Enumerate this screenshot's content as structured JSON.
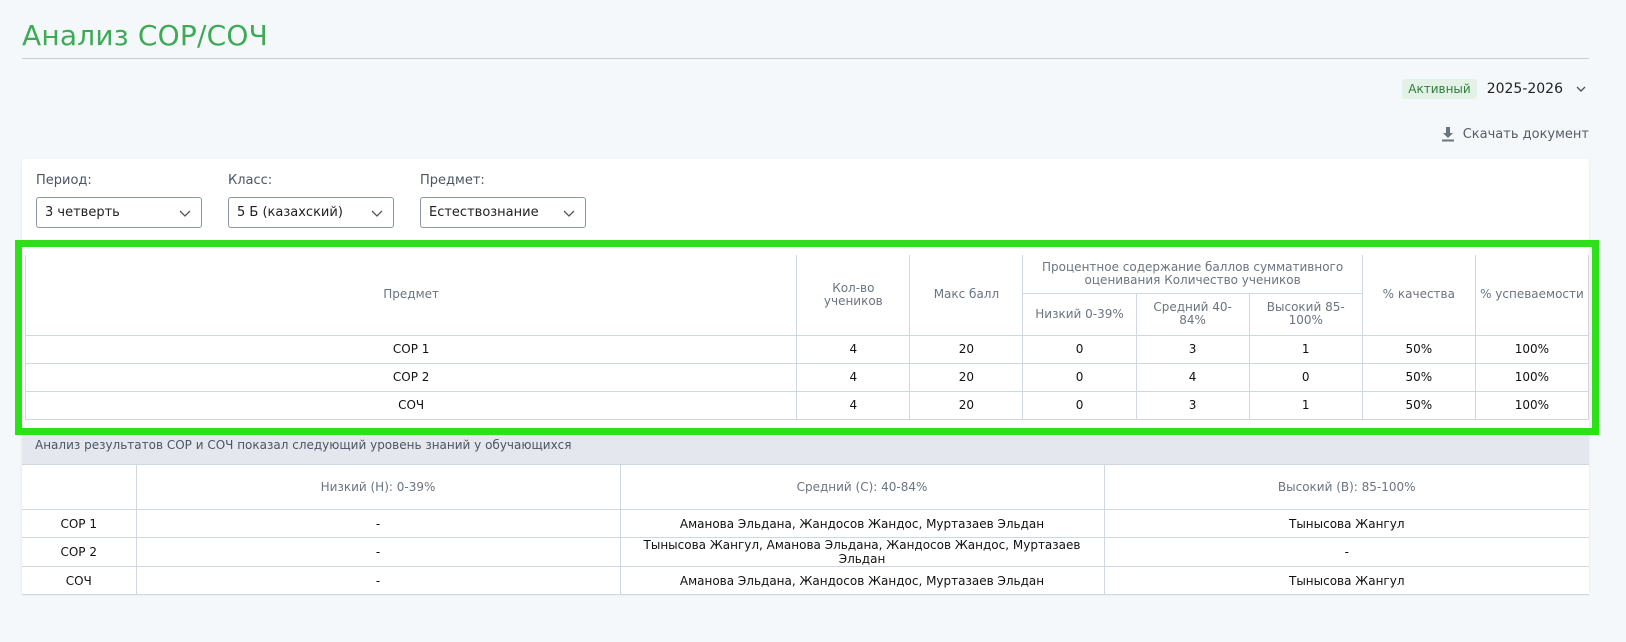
{
  "header": {
    "title": "Анализ СОР/СОЧ",
    "status_badge": "Активный",
    "academic_year": "2025-2026",
    "download_label": "Скачать документ"
  },
  "filters": {
    "period": {
      "label": "Период:",
      "value": "3 четверть"
    },
    "class": {
      "label": "Класс:",
      "value": "5 Б (казахский)"
    },
    "subject": {
      "label": "Предмет:",
      "value": "Естествознание"
    }
  },
  "summary_table": {
    "headers": {
      "subject": "Предмет",
      "students": "Кол-во учеников",
      "max_score": "Макс балл",
      "group": "Процентное содержание баллов суммативного оценивания Количество учеников",
      "low": "Низкий 0-39%",
      "mid": "Средний 40-84%",
      "high": "Высокий 85-100%",
      "quality": "% качества",
      "progress": "% успеваемости"
    },
    "rows": [
      {
        "subject": "СОР 1",
        "students": "4",
        "max": "20",
        "low": "0",
        "mid": "3",
        "high": "1",
        "quality": "50%",
        "progress": "100%"
      },
      {
        "subject": "СОР 2",
        "students": "4",
        "max": "20",
        "low": "0",
        "mid": "4",
        "high": "0",
        "quality": "50%",
        "progress": "100%"
      },
      {
        "subject": "СОЧ",
        "students": "4",
        "max": "20",
        "low": "0",
        "mid": "3",
        "high": "1",
        "quality": "50%",
        "progress": "100%"
      }
    ]
  },
  "analysis": {
    "caption": "Анализ результатов СОР и СОЧ показал следующий уровень знаний у обучающихся",
    "headers": {
      "low": "Низкий (Н): 0-39%",
      "mid": "Средний (С): 40-84%",
      "high": "Высокий (В): 85-100%"
    },
    "rows": [
      {
        "name": "СОР 1",
        "low": "-",
        "mid": "Аманова Эльдана, Жандосов Жандос, Муртазаев Эльдан",
        "high": "Тынысова Жангул"
      },
      {
        "name": "СОР 2",
        "low": "-",
        "mid": "Тынысова Жангул, Аманова Эльдана, Жандосов Жандос, Муртазаев Эльдан",
        "high": "-"
      },
      {
        "name": "СОЧ",
        "low": "-",
        "mid": "Аманова Эльдана, Жандосов Жандос, Муртазаев Эльдан",
        "high": "Тынысова Жангул"
      }
    ]
  },
  "colors": {
    "accent": "#3eaa56",
    "highlight": "#2ee01a"
  }
}
